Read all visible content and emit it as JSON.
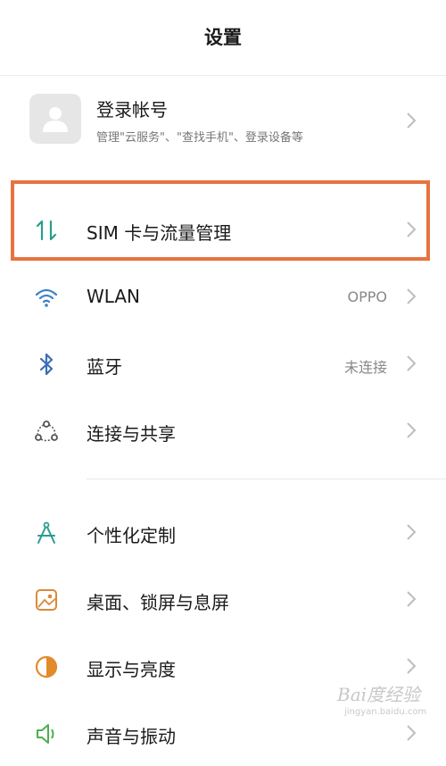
{
  "header": {
    "title": "设置"
  },
  "account": {
    "title": "登录帐号",
    "subtitle": "管理\"云服务\"、\"查找手机\"、登录设备等"
  },
  "items": [
    {
      "label": "SIM 卡与流量管理",
      "value": "",
      "icon": "sim-data-icon",
      "color": "#2a9d8f"
    },
    {
      "label": "WLAN",
      "value": "OPPO",
      "icon": "wifi-icon",
      "color": "#3b82c4"
    },
    {
      "label": "蓝牙",
      "value": "未连接",
      "icon": "bluetooth-icon",
      "color": "#3b6fb5"
    },
    {
      "label": "连接与共享",
      "value": "",
      "icon": "share-icon",
      "color": "#555555"
    },
    {
      "label": "个性化定制",
      "value": "",
      "icon": "personalize-icon",
      "color": "#2a9d8f"
    },
    {
      "label": "桌面、锁屏与息屏",
      "value": "",
      "icon": "wallpaper-icon",
      "color": "#d98b3a"
    },
    {
      "label": "显示与亮度",
      "value": "",
      "icon": "brightness-icon",
      "color": "#e28b2a"
    },
    {
      "label": "声音与振动",
      "value": "",
      "icon": "sound-icon",
      "color": "#4caf50"
    }
  ],
  "watermark": {
    "logo": "Bai度经验",
    "url": "jingyan.baidu.com"
  },
  "colors": {
    "highlight": "#e8733f"
  }
}
